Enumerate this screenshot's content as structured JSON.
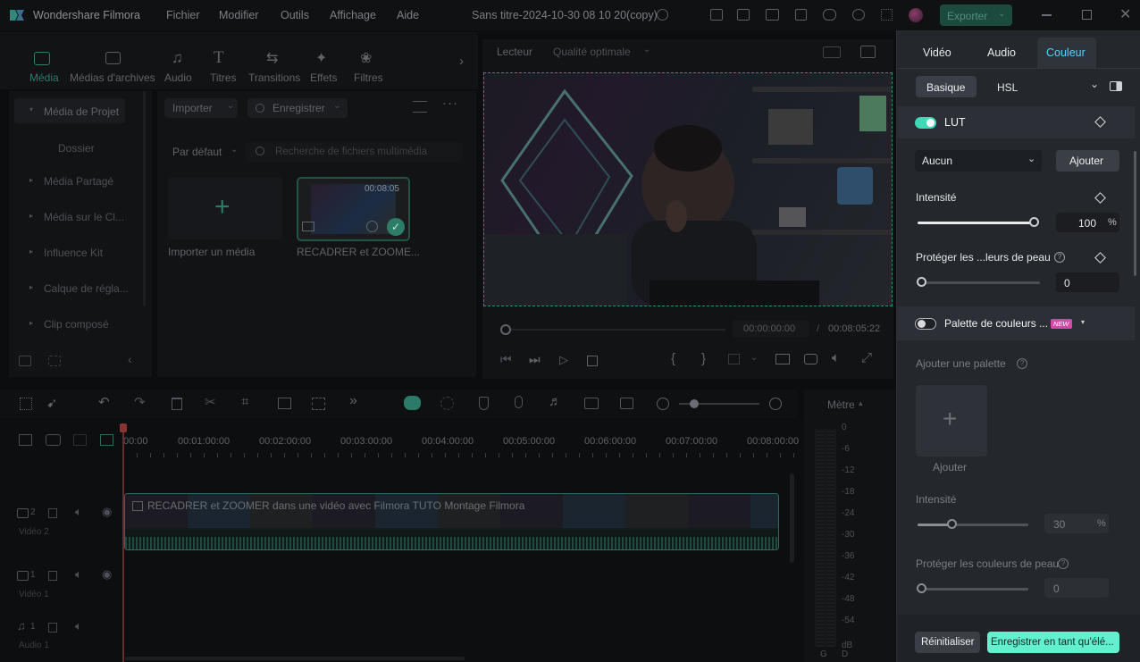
{
  "app": {
    "title": "Wondershare Filmora",
    "project": "Sans titre-2024-10-30 08 10 20(copy)",
    "export_label": "Exporter"
  },
  "menu": [
    "Fichier",
    "Modifier",
    "Outils",
    "Affichage",
    "Aide"
  ],
  "media_tabs": [
    {
      "label": "Média",
      "icon": "media-icon"
    },
    {
      "label": "Médias d'archives",
      "icon": "stock-media-icon"
    },
    {
      "label": "Audio",
      "icon": "music-note-icon"
    },
    {
      "label": "Titres",
      "icon": "text-icon"
    },
    {
      "label": "Transitions",
      "icon": "transitions-icon"
    },
    {
      "label": "Effets",
      "icon": "effects-icon"
    },
    {
      "label": "Filtres",
      "icon": "filters-icon"
    }
  ],
  "sidebar": [
    "Média de Projet",
    "Dossier",
    "Média Partagé",
    "Média sur le Cl...",
    "Influence Kit",
    "Calque de régla...",
    "Clip composé"
  ],
  "media_toolbar": {
    "import": "Importer",
    "record": "Enregistrer",
    "sort": "Par défaut",
    "search_placeholder": "Recherche de fichiers multimédia"
  },
  "media_items": {
    "import_label": "Importer un média",
    "clip_name": "RECADRER et ZOOME...",
    "clip_duration": "00:08:05"
  },
  "player": {
    "label": "Lecteur",
    "quality": "Qualité optimale",
    "current_time": "00:00:00:00",
    "separator": "/",
    "total_time": "00:08:05:22"
  },
  "timeline": {
    "ruler": [
      "00:00",
      "00:01:00:00",
      "00:02:00:00",
      "00:03:00:00",
      "00:04:00:00",
      "00:05:00:00",
      "00:06:00:00",
      "00:07:00:00",
      "00:08:00:00"
    ],
    "clip_title": "RECADRER et ZOOMER dans une vidéo avec Filmora  TUTO Montage Filmora",
    "tracks": [
      {
        "num": "2",
        "name": "Vidéo 2"
      },
      {
        "num": "1",
        "name": "Vidéo 1"
      },
      {
        "num": "1",
        "name": "Audio 1"
      }
    ],
    "meter_label": "Mètre",
    "meter_scale": [
      "0",
      "-6",
      "-12",
      "-18",
      "-24",
      "-30",
      "-36",
      "-42",
      "-48",
      "-54",
      "dB"
    ],
    "meter_channels": [
      "G",
      "D"
    ]
  },
  "color_panel": {
    "tabs": [
      "Vidéo",
      "Audio",
      "Couleur"
    ],
    "subtabs": [
      "Basique",
      "HSL"
    ],
    "lut_label": "LUT",
    "lut_value": "Aucun",
    "add_label": "Ajouter",
    "intensity_label": "Intensité",
    "intensity_value": "100",
    "percent": "%",
    "protect_label": "Protéger les ...leurs de peau",
    "protect_value": "0",
    "palette_label": "Palette de couleurs ...",
    "new_badge": "NEW",
    "add_palette_label": "Ajouter une palette",
    "add_tile_label": "Ajouter",
    "intensity2_label": "Intensité",
    "intensity2_value": "30",
    "protect2_label": "Protéger les couleurs de peau",
    "protect2_value": "0",
    "reset_label": "Réinitialiser",
    "save_label": "Enregistrer en tant qu'élé..."
  },
  "colors": {
    "accent": "#3fd9b8",
    "save_bg": "#62f0cf",
    "tab_active": "#55d3ff",
    "new_badge": "#d648a8"
  }
}
